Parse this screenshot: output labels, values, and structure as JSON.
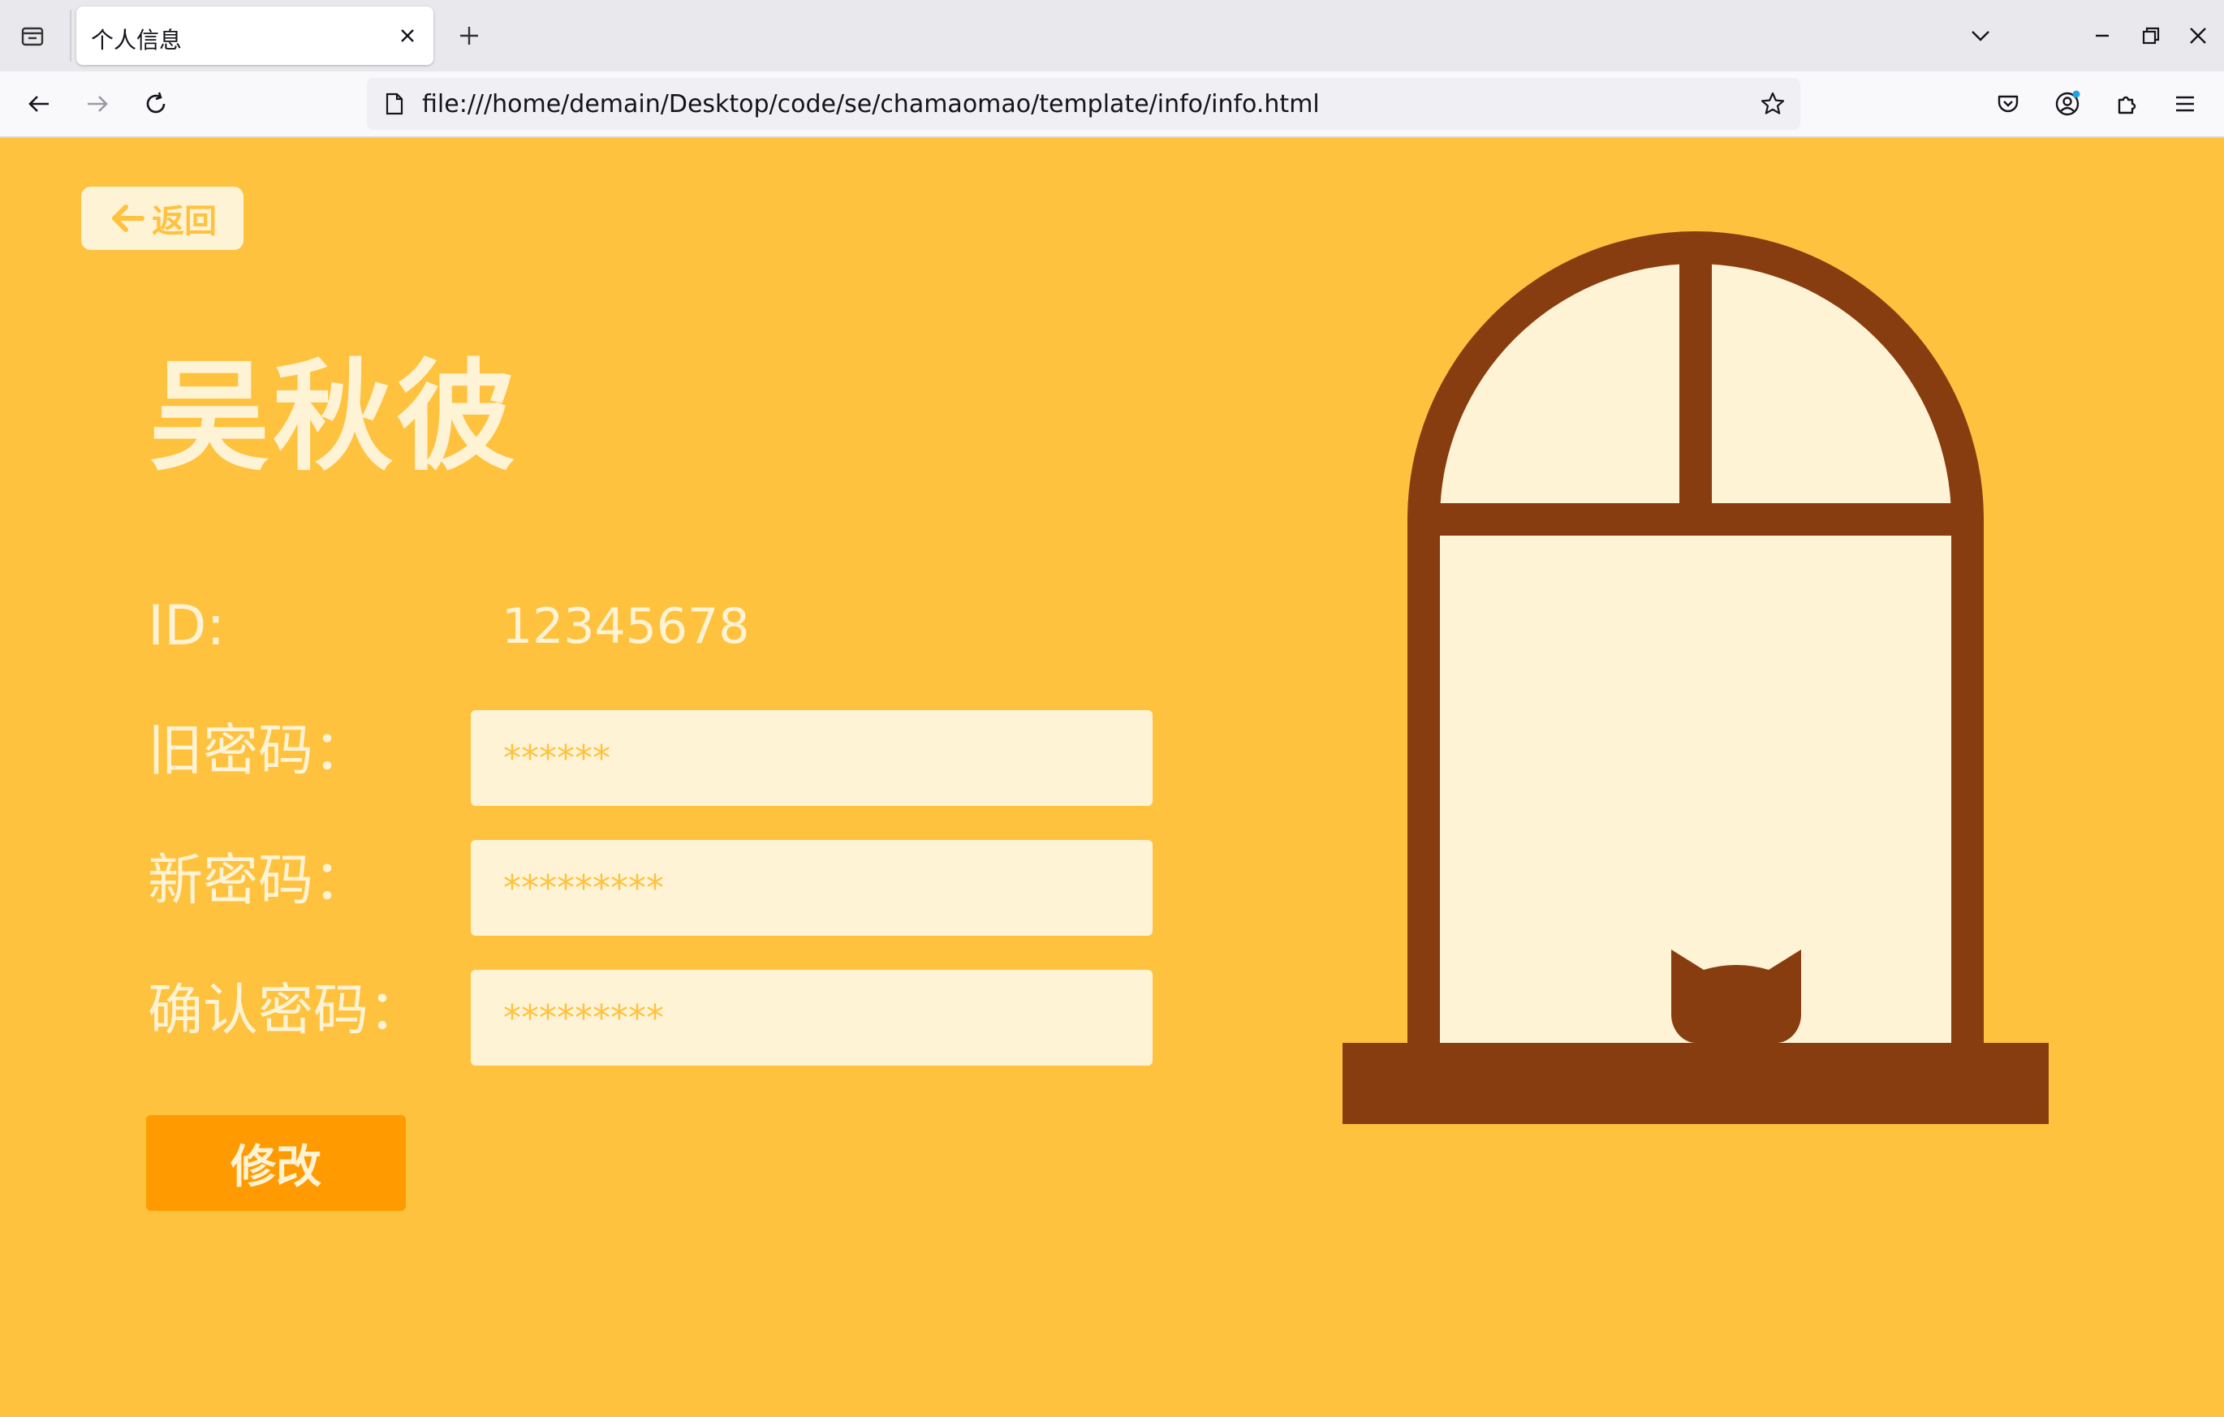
{
  "browser": {
    "tab_title": "个人信息",
    "url": "file:///home/demain/Desktop/code/se/chamaomao/template/info/info.html",
    "icons": {
      "tab_list": "tab-list-icon",
      "close": "close-icon",
      "new_tab": "plus-icon",
      "list_all_tabs": "chevron-down-icon",
      "minimize": "minimize-icon",
      "restore": "restore-icon",
      "window_close": "close-icon",
      "back": "arrow-left-icon",
      "forward": "arrow-right-icon",
      "reload": "reload-icon",
      "page": "page-icon",
      "bookmark": "star-icon",
      "pocket": "pocket-icon",
      "account": "account-icon",
      "extensions": "puzzle-icon",
      "menu": "hamburger-menu-icon"
    }
  },
  "page": {
    "back_label": "返回",
    "user_name": "吴秋彼",
    "id_label": "ID:",
    "id_value": "12345678",
    "old_password_label": "旧密码：",
    "old_password_placeholder": "******",
    "new_password_label": "新密码：",
    "new_password_placeholder": "*********",
    "confirm_password_label": "确认密码：",
    "confirm_password_placeholder": "*********",
    "submit_label": "修改"
  },
  "colors": {
    "background": "#ffc23e",
    "cream": "#fff3d6",
    "window_frame": "#873d10",
    "button": "#ff9a00"
  }
}
